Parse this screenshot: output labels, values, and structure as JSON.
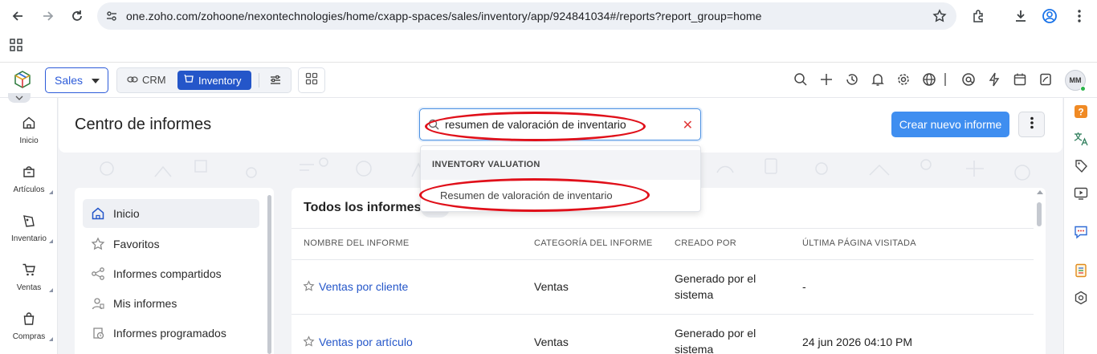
{
  "browser": {
    "url": "one.zoho.com/zohoone/nexontechnologies/home/cxapp-spaces/sales/inventory/app/924841034#/reports?report_group=home"
  },
  "appbar": {
    "space_select": "Sales",
    "crm_label": "CRM",
    "inventory_label": "Inventory",
    "avatar_initials": "MM"
  },
  "leftnav": {
    "items": [
      {
        "label": "Inicio",
        "icon": "home-icon"
      },
      {
        "label": "Artículos",
        "icon": "box-icon"
      },
      {
        "label": "Inventario",
        "icon": "inventory-icon"
      },
      {
        "label": "Ventas",
        "icon": "cart-icon"
      },
      {
        "label": "Compras",
        "icon": "bag-icon"
      }
    ]
  },
  "header": {
    "title": "Centro de informes",
    "search_value": "resumen de valoración de inventario",
    "create_button": "Crear nuevo informe"
  },
  "search_dropdown": {
    "group_label": "INVENTORY VALUATION",
    "item_label": "Resumen de valoración de inventario"
  },
  "sidebar": {
    "items": [
      {
        "label": "Inicio",
        "icon": "home-icon",
        "active": true
      },
      {
        "label": "Favoritos",
        "icon": "star-icon",
        "active": false
      },
      {
        "label": "Informes compartidos",
        "icon": "share-icon",
        "active": false
      },
      {
        "label": "Mis informes",
        "icon": "user-icon",
        "active": false
      },
      {
        "label": "Informes programados",
        "icon": "schedule-icon",
        "active": false
      }
    ]
  },
  "reports": {
    "title": "Todos los informes",
    "columns": [
      "NOMBRE DEL INFORME",
      "CATEGORÍA DEL INFORME",
      "CREADO POR",
      "ÚLTIMA PÁGINA VISITADA"
    ],
    "rows": [
      {
        "name": "Ventas por cliente",
        "category": "Ventas",
        "created_by_1": "Generado por el",
        "created_by_2": "sistema",
        "last_visited": "-"
      },
      {
        "name": "Ventas por artículo",
        "category": "Ventas",
        "created_by_1": "Generado por el",
        "created_by_2": "sistema",
        "last_visited": "24 jun 2026 04:10 PM"
      }
    ]
  },
  "colors": {
    "accent": "#2456c9",
    "create_button": "#3f8ef0",
    "annotation": "#e0101a"
  }
}
